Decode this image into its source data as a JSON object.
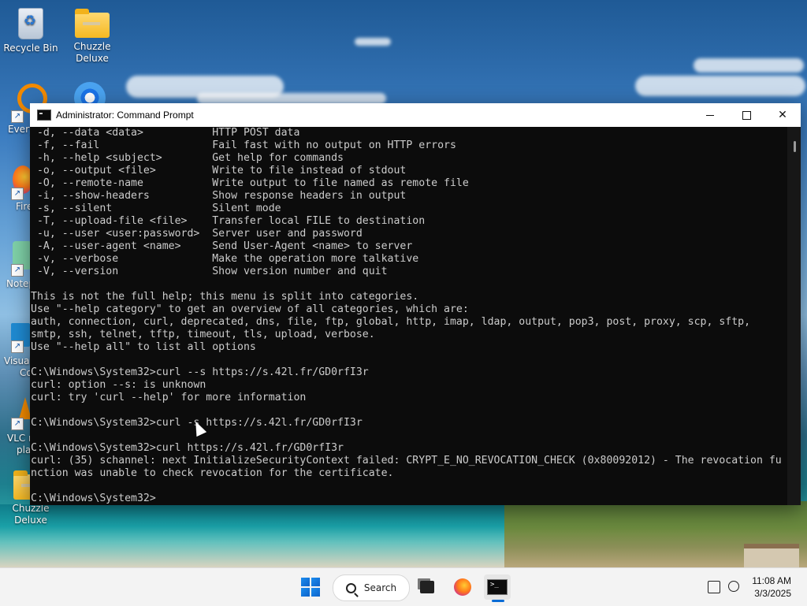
{
  "desktop": {
    "icons": [
      {
        "label": "Recycle Bin"
      },
      {
        "label": "Chuzzle\nDeluxe"
      },
      {
        "label": "Chuzzle\nDeluxe"
      }
    ],
    "partial_labels": [
      "Every",
      "Fire",
      "Notep",
      "Visual",
      "Co",
      "VLC r",
      "pla"
    ]
  },
  "window": {
    "title": "Administrator: Command Prompt",
    "controls": {
      "minimize": "minimize-icon",
      "maximize": "maximize-icon",
      "close": "close-icon"
    },
    "console_lines": [
      " -d, --data <data>           HTTP POST data",
      " -f, --fail                  Fail fast with no output on HTTP errors",
      " -h, --help <subject>        Get help for commands",
      " -o, --output <file>         Write to file instead of stdout",
      " -O, --remote-name           Write output to file named as remote file",
      " -i, --show-headers          Show response headers in output",
      " -s, --silent                Silent mode",
      " -T, --upload-file <file>    Transfer local FILE to destination",
      " -u, --user <user:password>  Server user and password",
      " -A, --user-agent <name>     Send User-Agent <name> to server",
      " -v, --verbose               Make the operation more talkative",
      " -V, --version               Show version number and quit",
      "",
      "This is not the full help; this menu is split into categories.",
      "Use \"--help category\" to get an overview of all categories, which are:",
      "auth, connection, curl, deprecated, dns, file, ftp, global, http, imap, ldap, output, pop3, post, proxy, scp, sftp,",
      "smtp, ssh, telnet, tftp, timeout, tls, upload, verbose.",
      "Use \"--help all\" to list all options",
      "",
      "C:\\Windows\\System32>curl --s https://s.42l.fr/GD0rfI3r",
      "curl: option --s: is unknown",
      "curl: try 'curl --help' for more information",
      "",
      "C:\\Windows\\System32>curl -s https://s.42l.fr/GD0rfI3r",
      "",
      "C:\\Windows\\System32>curl https://s.42l.fr/GD0rfI3r",
      "curl: (35) schannel: next InitializeSecurityContext failed: CRYPT_E_NO_REVOCATION_CHECK (0x80092012) - The revocation fu",
      "nction was unable to check revocation for the certificate.",
      "",
      "C:\\Windows\\System32>"
    ]
  },
  "taskbar": {
    "search_label": "Search",
    "apps": [
      "start-icon",
      "search-icon",
      "task-view-icon",
      "firefox-icon",
      "command-prompt-icon"
    ],
    "clock": {
      "time": "11:08 AM",
      "date": "3/3/2025"
    }
  },
  "colors": {
    "console_bg": "#0c0c0c",
    "console_text": "#cccccc",
    "taskbar_bg": "#f3f3f3",
    "accent": "#0a6cd6"
  }
}
